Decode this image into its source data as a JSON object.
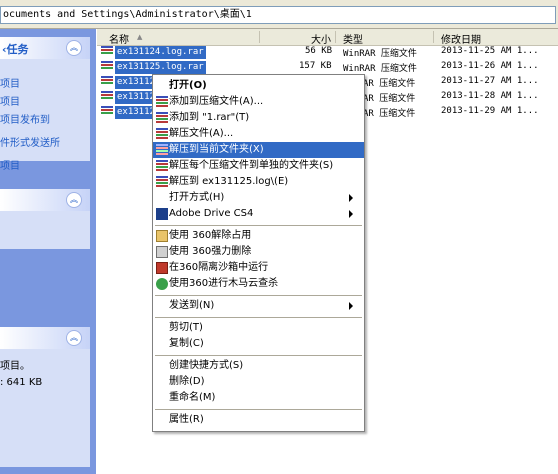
{
  "address": {
    "path": "ocuments and Settings\\Administrator\\桌面\\1"
  },
  "taskpane": {
    "box1": {
      "title": "‹任务",
      "links": [
        "项目",
        "项目",
        "项目发布到",
        "件形式发送所",
        "项目"
      ]
    },
    "box3": {
      "lines": [
        "项目。",
        ": 641 KB"
      ]
    }
  },
  "columns": {
    "name": "名称",
    "size": "大小",
    "type": "类型",
    "modified": "修改日期"
  },
  "files": [
    {
      "name": "ex131124.log.rar",
      "size": "56 KB",
      "type": "WinRAR 压缩文件",
      "modified": "2013-11-25  AM 1..."
    },
    {
      "name": "ex131125.log.rar",
      "size": "157 KB",
      "type": "WinRAR 压缩文件",
      "modified": "2013-11-26  AM 1..."
    },
    {
      "name": "ex13112",
      "size": "",
      "type": "AR 压缩文件",
      "modified": "2013-11-27  AM 1..."
    },
    {
      "name": "ex13112",
      "size": "",
      "type": "AR 压缩文件",
      "modified": "2013-11-28  AM 1..."
    },
    {
      "name": "ex13112",
      "size": "",
      "type": "AR 压缩文件",
      "modified": "2013-11-29  AM 1..."
    }
  ],
  "menu": {
    "open": "打开(O)",
    "add_archive": "添加到压缩文件(A)...",
    "add_to_rar": "添加到 \"1.rar\"(T)",
    "extract_files": "解压文件(A)...",
    "extract_here": "解压到当前文件夹(X)",
    "extract_each": "解压每个压缩文件到单独的文件夹(S)",
    "extract_to": "解压到 ex131125.log\\(E)",
    "open_with": "打开方式(H)",
    "adobe_drive": "Adobe Drive CS4",
    "unlock360": "使用 360解除占用",
    "delete360": "使用 360强力删除",
    "sandbox360": "在360隔离沙箱中运行",
    "scan360": "使用360进行木马云查杀",
    "send_to": "发送到(N)",
    "cut": "剪切(T)",
    "copy": "复制(C)",
    "shortcut": "创建快捷方式(S)",
    "delete": "删除(D)",
    "rename": "重命名(M)",
    "properties": "属性(R)"
  },
  "colors": {
    "selection": "#316ac5",
    "taskpane_bg": "#7a97df",
    "link": "#215dc6"
  }
}
